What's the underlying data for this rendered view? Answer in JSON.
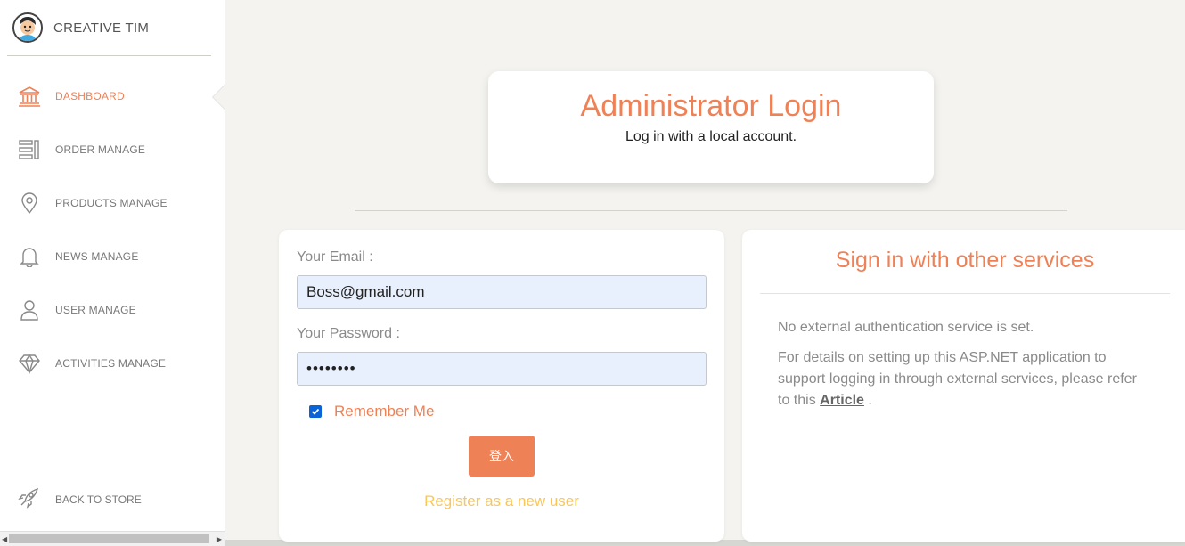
{
  "brand": {
    "name": "CREATIVE TIM"
  },
  "sidebar": {
    "items": [
      {
        "label": "DASHBOARD",
        "icon": "bank-icon",
        "active": true
      },
      {
        "label": "ORDER MANAGE",
        "icon": "list-icon",
        "active": false
      },
      {
        "label": "PRODUCTS MANAGE",
        "icon": "pin-icon",
        "active": false
      },
      {
        "label": "NEWS MANAGE",
        "icon": "bell-icon",
        "active": false
      },
      {
        "label": "USER MANAGE",
        "icon": "user-icon",
        "active": false
      },
      {
        "label": "ACTIVITIES MANAGE",
        "icon": "diamond-icon",
        "active": false
      }
    ],
    "back_to_store": "BACK TO STORE"
  },
  "header": {
    "title": "Administrator Login",
    "subtitle": "Log in with a local account."
  },
  "login": {
    "email_label": "Your Email :",
    "email_value": "Boss@gmail.com",
    "password_label": "Your Password :",
    "password_value": "••••••••",
    "remember_label": "Remember Me",
    "remember_checked": true,
    "submit_label": "登入",
    "register_link": "Register as a new user"
  },
  "external": {
    "title": "Sign in with other services",
    "line1": "No external authentication service is set.",
    "line2": "For details on setting up this ASP.NET application to support logging in through external services, please refer to this",
    "link": "Article",
    "tail": "."
  },
  "colors": {
    "accent": "#ef8157",
    "warning": "#fbc658",
    "background": "#f4f3ef"
  }
}
